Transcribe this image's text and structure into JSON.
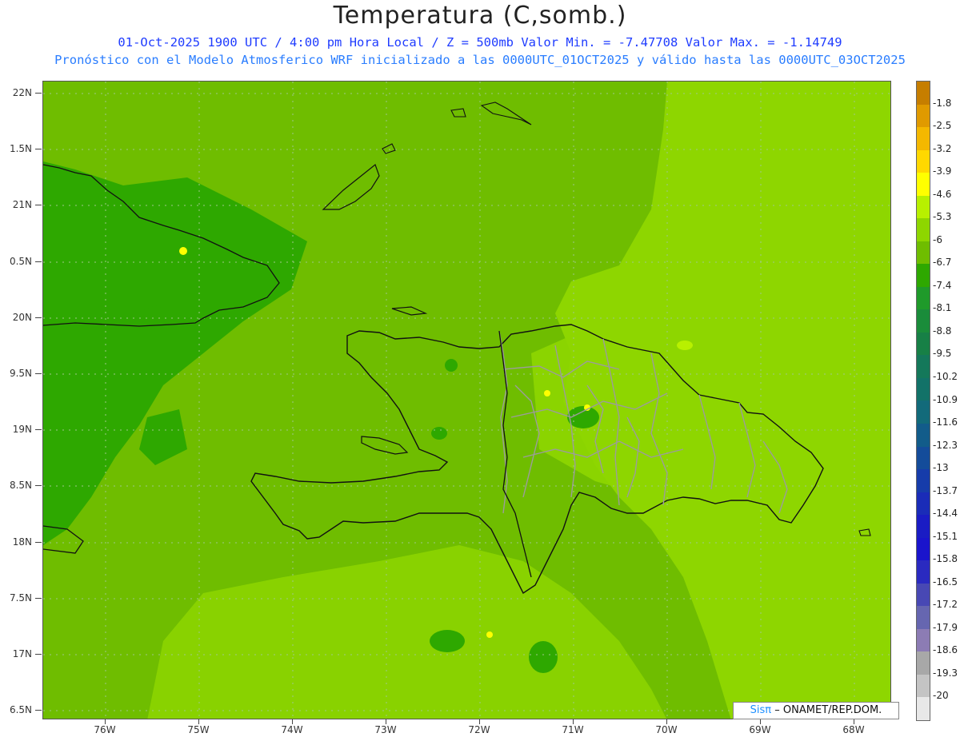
{
  "title": "Temperatura (C,somb.)",
  "subtitle_1": "01-Oct-2025  1900 UTC / 4:00 pm Hora Local / Z = 500mb  Valor Min. = -7.47708  Valor Max. = -1.14749",
  "subtitle_2": "Pronóstico con el Modelo Atmosferico WRF inicializado a las 0000UTC_01OCT2025 y válido hasta las  0000UTC_03OCT2025",
  "lat_labels": [
    "22N",
    "1.5N",
    "21N",
    "0.5N",
    "20N",
    "9.5N",
    "19N",
    "8.5N",
    "18N",
    "7.5N",
    "17N",
    "6.5N"
  ],
  "lon_labels": [
    "76W",
    "75W",
    "74W",
    "73W",
    "72W",
    "71W",
    "70W",
    "69W",
    "68W"
  ],
  "colorbar": {
    "labels": [
      "-1.8",
      "-2.5",
      "-3.2",
      "-3.9",
      "-4.6",
      "-5.3",
      "-6",
      "-6.7",
      "-7.4",
      "-8.1",
      "-8.8",
      "-9.5",
      "-10.2",
      "-10.9",
      "-11.6",
      "-12.3",
      "-13",
      "-13.7",
      "-14.4",
      "-15.1",
      "-15.8",
      "-16.5",
      "-17.2",
      "-17.9",
      "-18.6",
      "-19.3",
      "-20"
    ],
    "colors": [
      "#c67e00",
      "#e09a00",
      "#f4b800",
      "#ffd800",
      "#ffff00",
      "#b8f000",
      "#8ed600",
      "#6fbd00",
      "#2ea800",
      "#1f9a2a",
      "#1a8c3a",
      "#178046",
      "#14785a",
      "#127268",
      "#126a7a",
      "#125c8a",
      "#144c9a",
      "#163caa",
      "#1a2cb8",
      "#1a1cc4",
      "#1a14cc",
      "#2a2ac0",
      "#4848b4",
      "#6666b0",
      "#8c7cb4",
      "#a8a8a8",
      "#c4c4c4",
      "#e8e8e8"
    ]
  },
  "credit": {
    "sis": "Sisπ",
    "rest": "– ONAMET/REP.DOM."
  }
}
